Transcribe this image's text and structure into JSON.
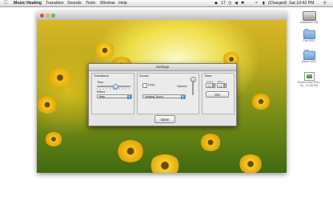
{
  "menubar": {
    "app_name": "Music Healing",
    "items": [
      "Transition",
      "Sounds",
      "Tools",
      "Window",
      "Help"
    ],
    "battery_status": "(Charged)",
    "clock": "Sat 10:42 PM",
    "status_number": "17"
  },
  "desktop": {
    "icons": [
      {
        "label": "Macintosh HD",
        "icon": "hard-drive-icon"
      },
      {
        "label": "Feb 2011",
        "icon": "folder-icon"
      },
      {
        "label": "March 2011",
        "icon": "folder-icon"
      },
      {
        "label": "Screen shot 2011-04...10.26 PM",
        "icon": "screenshot-file-icon"
      }
    ]
  },
  "settings": {
    "title": "Settings",
    "transitions": {
      "heading": "Transitions:",
      "time_label": "Time",
      "time_level": 0.55,
      "effect_label": "Effect:",
      "effect_value": "fade"
    },
    "sound": {
      "heading": "Sound:",
      "loop_label": "Loop",
      "loop_checked": false,
      "volume_label": "Volume",
      "volume_level": 0.92,
      "track_value": "Healing Touch"
    },
    "timer": {
      "heading": "Timer:",
      "hours_label": "Hours",
      "mins_label": "Mins",
      "hours_value": "00",
      "mins_value": "01",
      "go_label": "GO"
    },
    "done_label": "Done"
  },
  "colors": {
    "menubar_bg": "#e8e8e8",
    "dialog_bg": "#e4e4e4",
    "accent_blue": "#2f6fcf"
  }
}
